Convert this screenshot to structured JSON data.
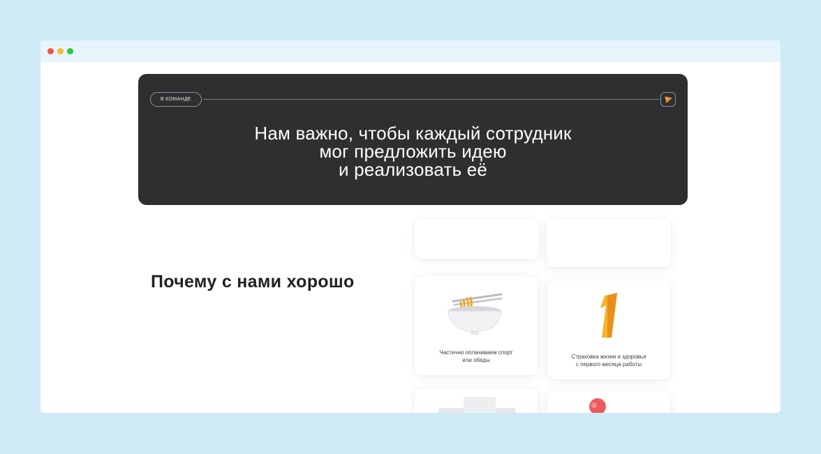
{
  "window": {
    "controls": [
      "close",
      "minimize",
      "maximize"
    ]
  },
  "hero": {
    "tag": "В КОМАНДЕ",
    "badge_icon": "pizza-icon",
    "title": "Нам важно, чтобы каждый сотрудник\nмог предложить идею\nи реализовать её"
  },
  "benefits": {
    "title": "Почему с нами хорошо",
    "cards": [
      {
        "caption": "Частично оплачиваем спорт\nили обеды",
        "icon": "noodle-bowl-icon"
      },
      {
        "caption": "Страховка жизни и здоровья\nс первого месяца работы",
        "icon": "number-one-icon"
      }
    ]
  },
  "colors": {
    "page_background": "#cfeaf7",
    "hero_background": "#2d2f31",
    "accent_orange": "#f5a623"
  }
}
